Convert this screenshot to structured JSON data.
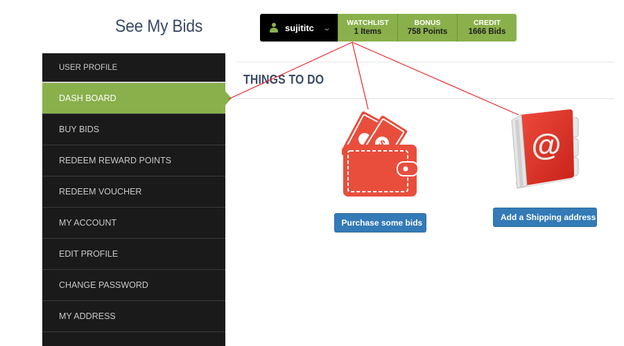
{
  "site": {
    "title": "See My Bids"
  },
  "topbar": {
    "user": {
      "name": "sujititc",
      "icon": "user-icon",
      "dropdown_icon": "chevron-down-icon"
    },
    "stats": [
      {
        "label": "WATCHLIST",
        "value": "1 Items"
      },
      {
        "label": "BONUS",
        "value": "758 Points"
      },
      {
        "label": "CREDIT",
        "value": "1666 Bids"
      }
    ]
  },
  "sidebar": {
    "header": "USER PROFILE",
    "items": [
      {
        "label": "DASH BOARD",
        "active": true
      },
      {
        "label": "BUY BIDS"
      },
      {
        "label": "REDEEM REWARD POINTS"
      },
      {
        "label": "REDEEM VOUCHER"
      },
      {
        "label": "MY ACCOUNT"
      },
      {
        "label": "EDIT PROFILE"
      },
      {
        "label": "CHANGE PASSWORD"
      },
      {
        "label": "MY ADDRESS"
      }
    ]
  },
  "main": {
    "title": "THINGS TO DO",
    "actions": [
      {
        "icon": "wallet-icon",
        "button": "Purchase some bids"
      },
      {
        "icon": "address-book-icon",
        "button": "Add a Shipping address"
      }
    ]
  },
  "colors": {
    "accent_green": "#8ab04b",
    "sidebar_bg": "#1a1a1a",
    "button_blue": "#337ab7",
    "title_navy": "#3a4a63",
    "icon_red": "#e94e3c",
    "annotation_red": "#e8232b"
  }
}
